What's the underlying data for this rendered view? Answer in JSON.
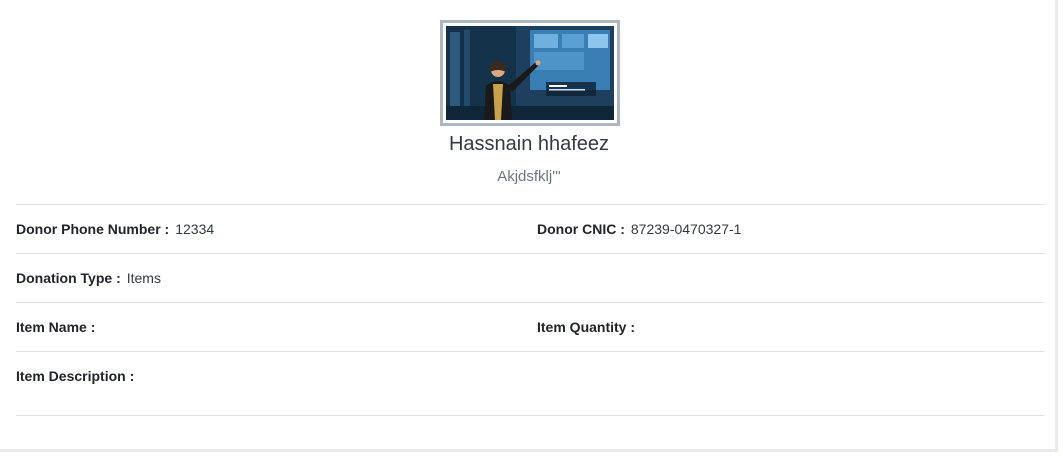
{
  "donor": {
    "name": "Hassnain hhafeez",
    "subtitle": "Akjdsfklj'''",
    "photo_icon": "person-presenting-screen-photo"
  },
  "details": {
    "phone_label": "Donor Phone Number :",
    "phone_value": "12334",
    "cnic_label": "Donor CNIC :",
    "cnic_value": "87239-0470327-1",
    "donation_type_label": "Donation Type :",
    "donation_type_value": "Items",
    "item_name_label": "Item Name :",
    "item_name_value": "",
    "item_quantity_label": "Item Quantity :",
    "item_quantity_value": "",
    "item_description_label": "Item Description :",
    "item_description_value": ""
  },
  "colors": {
    "photo_border": "#adb5bd",
    "divider": "#dee2e6",
    "muted_text": "#6c757d"
  }
}
